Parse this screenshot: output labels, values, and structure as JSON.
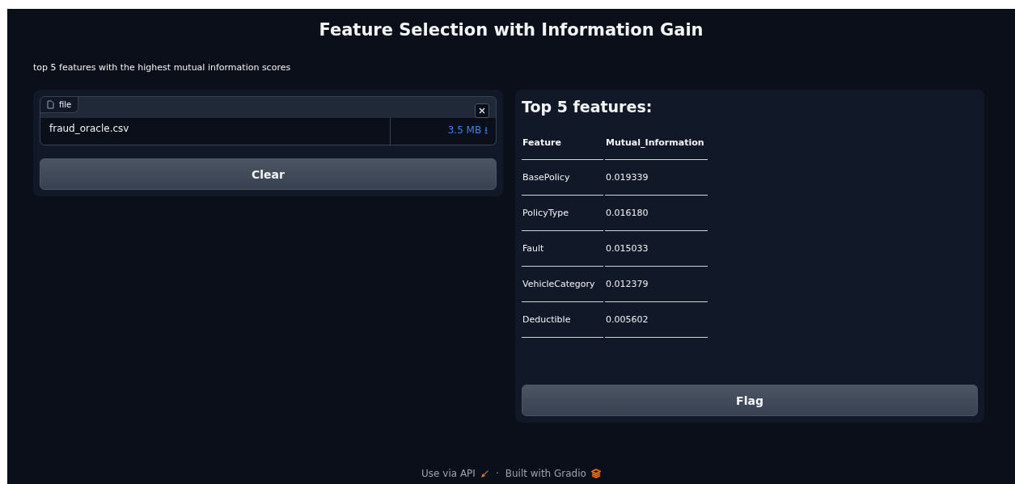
{
  "title": "Feature Selection with Information Gain",
  "description": "top 5 features with the highest mutual information scores",
  "file_input": {
    "label": "file",
    "file_name": "fraud_oracle.csv",
    "file_size": "3.5 MB",
    "download_icon": "⭳"
  },
  "clear_button": "Clear",
  "output": {
    "heading": "Top 5 features:",
    "columns": [
      "Feature",
      "Mutual_Information"
    ],
    "rows": [
      [
        "BasePolicy",
        "0.019339"
      ],
      [
        "PolicyType",
        "0.016180"
      ],
      [
        "Fault",
        "0.015033"
      ],
      [
        "VehicleCategory",
        "0.012379"
      ],
      [
        "Deductible",
        "0.005602"
      ]
    ]
  },
  "flag_button": "Flag",
  "footer": {
    "api_link": "Use via API",
    "separator": "·",
    "built_with": "Built with Gradio"
  }
}
